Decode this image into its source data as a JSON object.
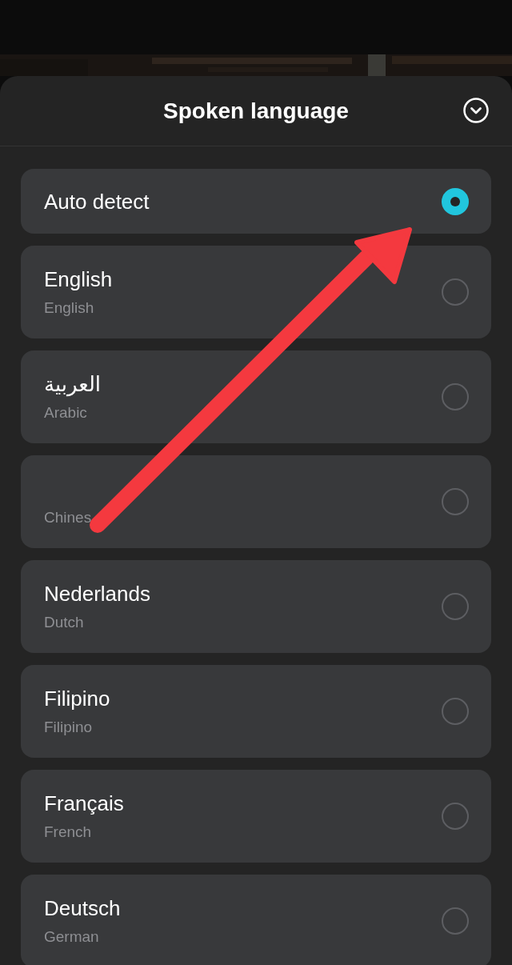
{
  "sheet": {
    "title": "Spoken language"
  },
  "languages": [
    {
      "name": "Auto detect",
      "selected": true
    },
    {
      "name": "English",
      "subtitle": "English",
      "selected": false
    },
    {
      "name": "العربية",
      "subtitle": "Arabic",
      "selected": false
    },
    {
      "subtitle": "Chines",
      "selected": false
    },
    {
      "name": "Nederlands",
      "subtitle": "Dutch",
      "selected": false
    },
    {
      "name": "Filipino",
      "subtitle": "Filipino",
      "selected": false
    },
    {
      "name": "Français",
      "subtitle": "French",
      "selected": false
    },
    {
      "name": "Deutsch",
      "subtitle": "German",
      "selected": false
    }
  ]
}
